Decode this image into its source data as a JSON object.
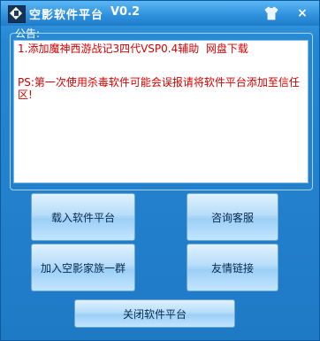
{
  "window": {
    "title": "空影软件平台",
    "version": "V0.2",
    "close_label": "×"
  },
  "notice": {
    "label": "公告:",
    "lines": [
      "1.添加魔神西游战记3四代VSP0.4辅助  网盘下载",
      "PS:第一次使用杀毒软件可能会误报请将软件平台添加至信任区!"
    ]
  },
  "buttons": {
    "load": "载入软件平台",
    "ask": "咨询客服",
    "join": "加入空影家族一群",
    "links": "友情链接",
    "close": "关闭软件平台"
  },
  "icons": {
    "app": "app-logo-icon",
    "skin": "shirt-icon",
    "close": "close-icon"
  }
}
